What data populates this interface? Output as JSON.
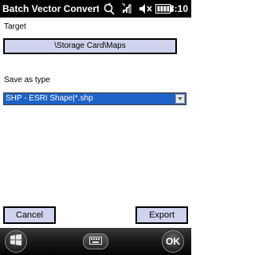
{
  "window": {
    "title": "Batch Vector Converter",
    "clock": "3:10"
  },
  "status_icons": [
    "sync-icon",
    "no-signal-icon",
    "volume-muted-icon",
    "battery-icon"
  ],
  "target": {
    "label": "Target",
    "path": "\\Storage Card\\Maps"
  },
  "save_as": {
    "label": "Save as type",
    "selected": "SHP - ESRI Shape|*.shp"
  },
  "buttons": {
    "cancel": "Cancel",
    "export": "Export"
  },
  "softbar": {
    "ok": "OK"
  },
  "colors": {
    "button_fill": "#cfd3ee",
    "selection": "#1e62c6",
    "title_bar": "#000000"
  }
}
